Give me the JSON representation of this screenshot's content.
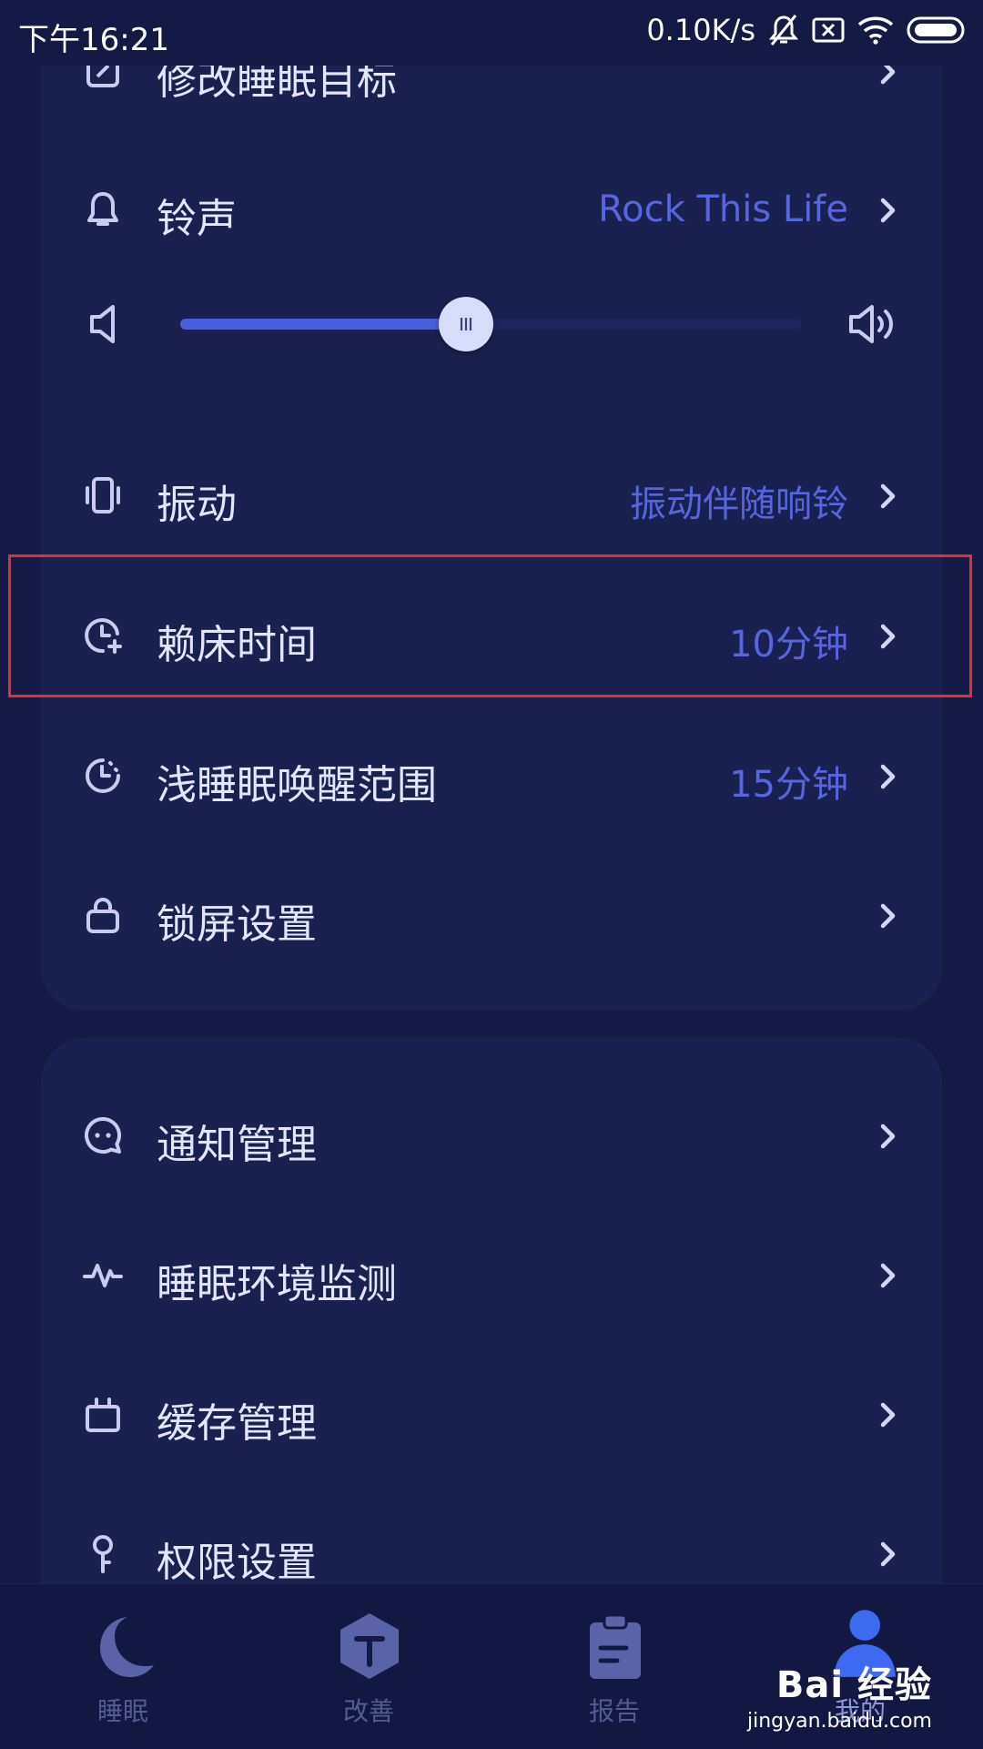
{
  "status_bar": {
    "time": "下午16:21",
    "net_speed": "0.10K/s",
    "icons": [
      "mute-bell-icon",
      "sim-off-icon",
      "wifi-icon",
      "battery-icon"
    ]
  },
  "alarm_settings": {
    "partial_item": {
      "label": "修改睡眠目标",
      "icon": "edit-icon"
    },
    "ringtone": {
      "label": "铃声",
      "value": "Rock This Life",
      "icon": "bell-icon"
    },
    "volume": {
      "level": 0.46,
      "icons": [
        "volume-low-icon",
        "volume-high-icon"
      ]
    },
    "vibration": {
      "label": "振动",
      "value": "振动伴随响铃",
      "icon": "vibrate-icon"
    },
    "snooze": {
      "label": "赖床时间",
      "value": "10分钟",
      "icon": "clock-plus-icon"
    },
    "light_sleep": {
      "label": "浅睡眠唤醒范围",
      "value": "15分钟",
      "icon": "clock-dashed-icon"
    },
    "lock_screen": {
      "label": "锁屏设置",
      "icon": "lock-icon"
    }
  },
  "general_settings": {
    "notifications": {
      "label": "通知管理",
      "icon": "chat-bubble-icon"
    },
    "environment": {
      "label": "睡眠环境监测",
      "icon": "pulse-icon"
    },
    "cache": {
      "label": "缓存管理",
      "icon": "tv-icon"
    },
    "permissions": {
      "label": "权限设置",
      "icon": "key-icon"
    }
  },
  "bottom_nav": {
    "items": [
      {
        "label": "睡眠",
        "icon": "moon-icon",
        "active": false
      },
      {
        "label": "改善",
        "icon": "arrow-up-hex-icon",
        "active": false
      },
      {
        "label": "报告",
        "icon": "clipboard-icon",
        "active": false
      },
      {
        "label": "我的",
        "icon": "person-icon",
        "active": true
      }
    ]
  },
  "watermark": {
    "logo": "Bai 经验",
    "url": "jingyan.baidu.com"
  },
  "colors": {
    "background": "#141a45",
    "card": "#1a2150",
    "accent": "#4a5ddd",
    "value_text": "#5566df",
    "highlight_border": "#e0322c"
  }
}
